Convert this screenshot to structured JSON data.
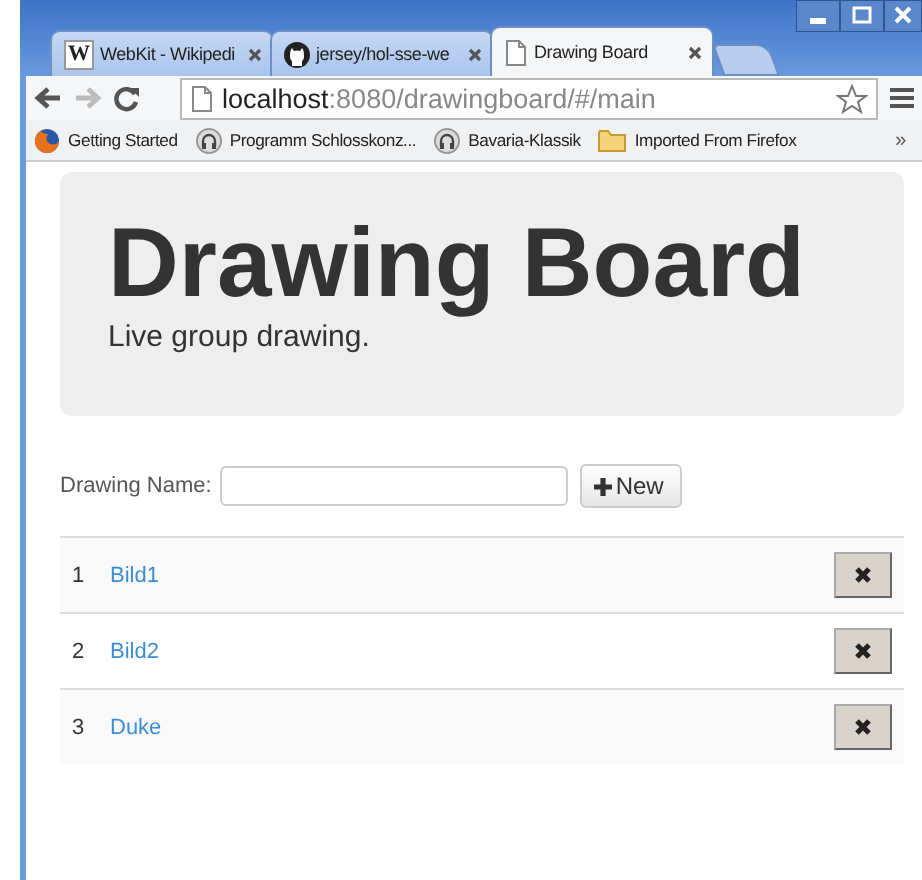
{
  "tabs": [
    {
      "title": "WebKit - Wikipedi",
      "selected": false,
      "kind": "letter",
      "icon_text": "W"
    },
    {
      "title": "jersey/hol-sse-we",
      "selected": false,
      "kind": "round"
    },
    {
      "title": "Drawing Board",
      "selected": true,
      "kind": "page"
    }
  ],
  "address": {
    "host": "localhost",
    "path": ":8080/drawingboard/#/main"
  },
  "bookmarks": [
    {
      "label": "Getting Started",
      "kind": "orange"
    },
    {
      "label": "Programm Schlosskonz...",
      "kind": "headphones"
    },
    {
      "label": "Bavaria-Klassik",
      "kind": "headphones"
    },
    {
      "label": "Imported From Firefox",
      "kind": "folder"
    }
  ],
  "bookmarks_more": "»",
  "page": {
    "heading": "Drawing Board",
    "tagline": "Live group drawing.",
    "name_label": "Drawing Name:",
    "new_button": "New",
    "drawings": [
      {
        "index": "1",
        "name": "Bild1"
      },
      {
        "index": "2",
        "name": "Bild2"
      },
      {
        "index": "3",
        "name": "Duke"
      }
    ]
  }
}
